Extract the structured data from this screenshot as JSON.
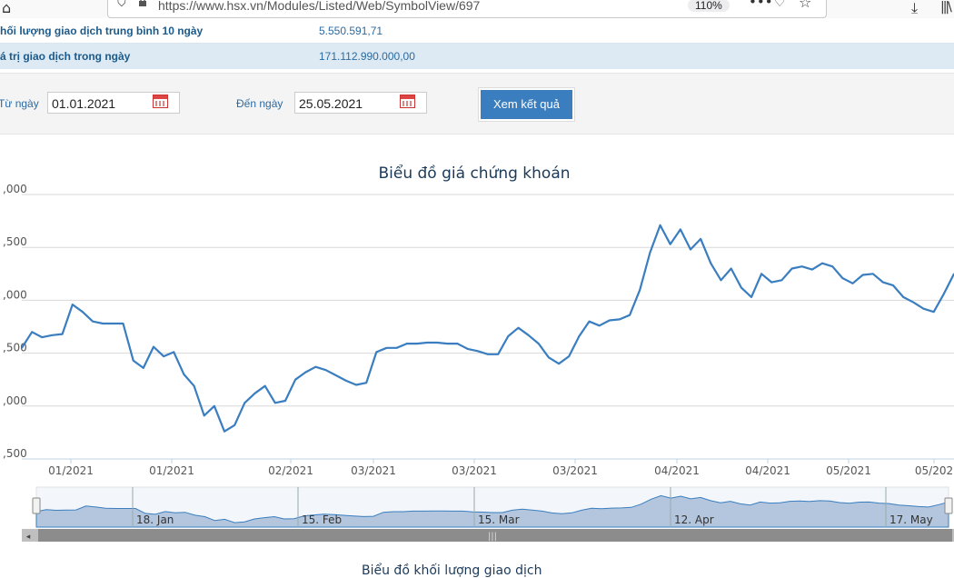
{
  "browser": {
    "url": "https://www.hsx.vn/Modules/Listed/Web/SymbolView/697",
    "zoom": "110%",
    "icons": [
      "home-icon",
      "shield-icon",
      "lock-icon",
      "more-icon",
      "pocket-icon",
      "star-icon",
      "download-icon",
      "library-icon"
    ]
  },
  "info": {
    "rows": [
      {
        "label": "hối lượng giao dịch trung bình 10 ngày",
        "value": "5.550.591,71"
      },
      {
        "label": "á trị giao dịch trong ngày",
        "value": "171.112.990.000,00"
      }
    ]
  },
  "filter": {
    "from_label": "Từ ngày",
    "from_value": "01.01.2021",
    "to_label": "Đến ngày",
    "to_value": "25.05.2021",
    "button": "Xem kết quả"
  },
  "chart_data": {
    "type": "line",
    "title": "Biểu đồ giá chứng khoán",
    "color": "#3a7ec0",
    "y_tick_labels": [
      ",000",
      ",500",
      ",000",
      ",500",
      ",000",
      ",500"
    ],
    "y_ticks": [
      16000,
      15500,
      15000,
      14500,
      14000,
      13500
    ],
    "ylim": [
      13500,
      16000
    ],
    "x_tick_labels": [
      "01/2021",
      "01/2021",
      "02/2021",
      "03/2021",
      "03/2021",
      "03/2021",
      "04/2021",
      "04/2021",
      "05/2021",
      "05/202"
    ],
    "navigator_labels": [
      "18. Jan",
      "15. Feb",
      "15. Mar",
      "12. Apr",
      "17. May"
    ],
    "values": [
      14550,
      14700,
      14650,
      14670,
      14680,
      14960,
      14890,
      14800,
      14780,
      14780,
      14780,
      14430,
      14360,
      14560,
      14470,
      14510,
      14300,
      14190,
      13910,
      14000,
      13760,
      13820,
      14030,
      14120,
      14190,
      14030,
      14050,
      14250,
      14320,
      14370,
      14340,
      14290,
      14240,
      14200,
      14220,
      14510,
      14550,
      14550,
      14590,
      14590,
      14600,
      14600,
      14590,
      14590,
      14540,
      14520,
      14490,
      14490,
      14660,
      14740,
      14670,
      14590,
      14460,
      14400,
      14470,
      14660,
      14800,
      14760,
      14810,
      14820,
      14860,
      15100,
      15450,
      15710,
      15530,
      15670,
      15480,
      15580,
      15350,
      15190,
      15300,
      15120,
      15030,
      15250,
      15170,
      15190,
      15300,
      15320,
      15290,
      15350,
      15320,
      15210,
      15160,
      15240,
      15250,
      15170,
      15140,
      15030,
      14980,
      14920,
      14890,
      15060,
      15250
    ]
  },
  "section2_title": "Biểu đồ khối lượng giao dịch"
}
